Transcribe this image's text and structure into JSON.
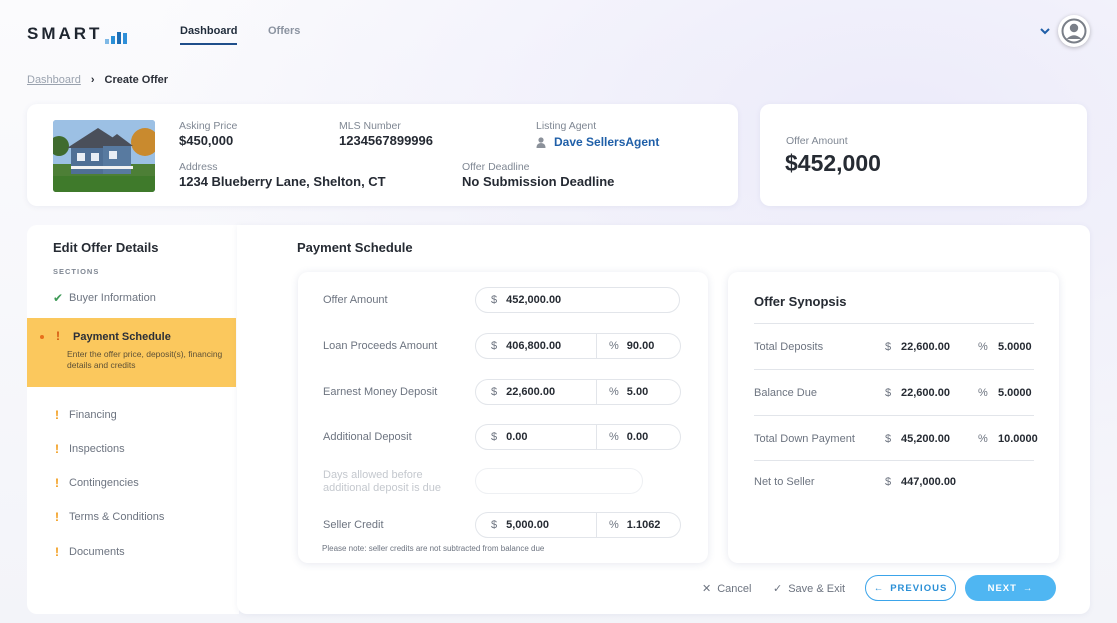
{
  "header": {
    "logo_text": "SMART",
    "nav": [
      {
        "label": "Dashboard",
        "active": true
      },
      {
        "label": "Offers",
        "active": false
      }
    ]
  },
  "breadcrumb": {
    "parent": "Dashboard",
    "separator": "›",
    "current": "Create Offer"
  },
  "listing": {
    "asking_price_label": "Asking Price",
    "asking_price": "$450,000",
    "mls_label": "MLS Number",
    "mls": "1234567899996",
    "agent_label": "Listing Agent",
    "agent": "Dave SellersAgent",
    "address_label": "Address",
    "address": "1234 Blueberry Lane, Shelton, CT",
    "deadline_label": "Offer Deadline",
    "deadline": "No Submission Deadline"
  },
  "offer_summary": {
    "label": "Offer Amount",
    "value": "$452,000"
  },
  "sidebar": {
    "title": "Edit Offer Details",
    "sections_label": "SECTIONS",
    "completed": {
      "label": "Buyer Information"
    },
    "active": {
      "label": "Payment Schedule",
      "description": "Enter the offer price, deposit(s), financing details and credits"
    },
    "pending": [
      {
        "label": "Financing"
      },
      {
        "label": "Inspections"
      },
      {
        "label": "Contingencies"
      },
      {
        "label": "Terms & Conditions"
      },
      {
        "label": "Documents"
      }
    ]
  },
  "payment_schedule": {
    "title": "Payment Schedule",
    "currency_symbol": "$",
    "percent_symbol": "%",
    "fields": [
      {
        "label": "Offer Amount",
        "amount": "452,000.00"
      },
      {
        "label": "Loan Proceeds Amount",
        "amount": "406,800.00",
        "percent": "90.00"
      },
      {
        "label": "Earnest Money Deposit",
        "amount": "22,600.00",
        "percent": "5.00"
      },
      {
        "label": "Additional Deposit",
        "amount": "0.00",
        "percent": "0.00"
      },
      {
        "label": "Days allowed before additional deposit is due"
      },
      {
        "label": "Seller Credit",
        "amount": "5,000.00",
        "percent": "1.1062"
      }
    ],
    "note": "Please note: seller credits are not subtracted from balance due"
  },
  "synopsis": {
    "title": "Offer Synopsis",
    "currency_symbol": "$",
    "percent_symbol": "%",
    "rows": [
      {
        "name": "Total Deposits",
        "amount": "22,600.00",
        "percent": "5.0000"
      },
      {
        "name": "Balance Due",
        "amount": "22,600.00",
        "percent": "5.0000"
      },
      {
        "name": "Total Down Payment",
        "amount": "45,200.00",
        "percent": "10.0000"
      },
      {
        "name": "Net to Seller",
        "amount": "447,000.00"
      }
    ]
  },
  "actions": {
    "cancel": "Cancel",
    "save_exit": "Save & Exit",
    "previous": "PREVIOUS",
    "next": "NEXT"
  },
  "colors": {
    "accent": "#2a8fd6",
    "active_section": "#fbc85d",
    "warning": "#f29b18",
    "success": "#3e9a57"
  }
}
